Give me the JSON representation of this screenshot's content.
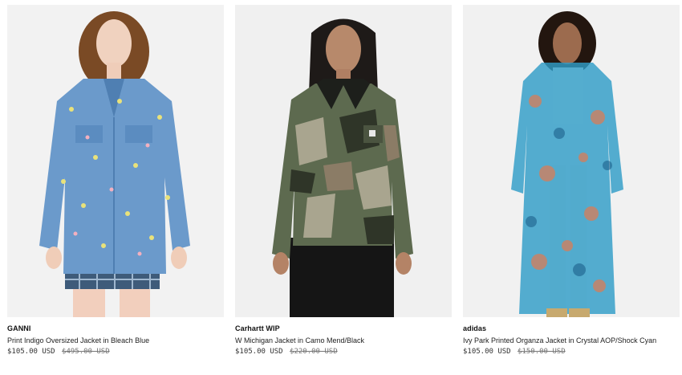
{
  "products": [
    {
      "brand": "GANNI",
      "name": "Print Indigo Oversized Jacket in Bleach Blue",
      "price": "$105.00 USD",
      "original_price": "$495.00 USD"
    },
    {
      "brand": "Carhartt WIP",
      "name": "W Michigan Jacket in Camo Mend/Black",
      "price": "$105.00 USD",
      "original_price": "$220.00 USD"
    },
    {
      "brand": "adidas",
      "name": "Ivy Park Printed Organza Jacket in Crystal AOP/Shock Cyan",
      "price": "$105.00 USD",
      "original_price": "$150.00 USD"
    }
  ]
}
